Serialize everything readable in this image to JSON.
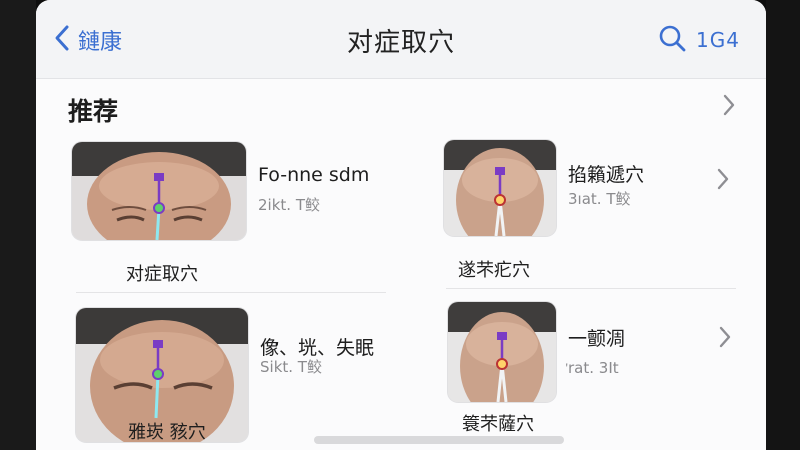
{
  "navbar": {
    "back_label": "鏈康",
    "title": "对症取穴",
    "search_label": "1G4"
  },
  "section": {
    "title": "推荐"
  },
  "cards": [
    {
      "title": "Fo-nne sdm",
      "subtitle": "2ikt. T鲛",
      "caption": "对症取穴"
    },
    {
      "title": "掐籟遞穴",
      "subtitle": "3ıat. T鲛",
      "caption": "遂芣疕穴"
    },
    {
      "title": "像ᡃ、垙、失眠",
      "subtitle": "Sikt. T鲛",
      "caption": "雅崁 豥穴"
    },
    {
      "title": "一颤凋",
      "subtitle": "ᡃrat. 3It",
      "caption": "簑芣薩穴"
    }
  ],
  "icons": {
    "back": "chevron-left-icon",
    "search": "search-icon",
    "more": "chevron-right-icon"
  },
  "colors": {
    "accent": "#3b6fd1",
    "meridian_line": "#7a3cc4",
    "acupoint": "#5fd16a",
    "meridian_glow": "#8ee8f0"
  }
}
